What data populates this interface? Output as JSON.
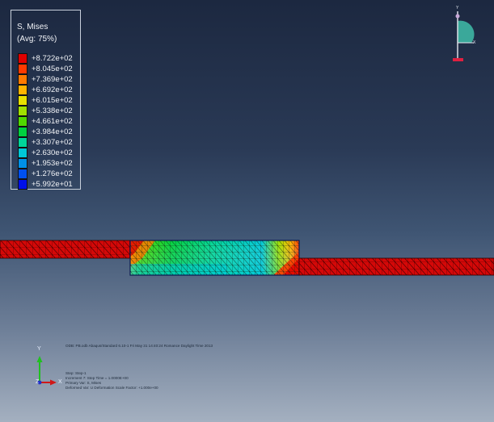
{
  "legend": {
    "title": "S, Mises",
    "subtitle": "(Avg: 75%)",
    "entries": [
      {
        "label": "+8.722e+02",
        "color": "#e00000"
      },
      {
        "label": "+8.045e+02",
        "color": "#ff3a00"
      },
      {
        "label": "+7.369e+02",
        "color": "#ff7a00"
      },
      {
        "label": "+6.692e+02",
        "color": "#ffb400"
      },
      {
        "label": "+6.015e+02",
        "color": "#e8e000"
      },
      {
        "label": "+5.338e+02",
        "color": "#a0e000"
      },
      {
        "label": "+4.661e+02",
        "color": "#50d800"
      },
      {
        "label": "+3.984e+02",
        "color": "#00d040"
      },
      {
        "label": "+3.307e+02",
        "color": "#00d49a"
      },
      {
        "label": "+2.630e+02",
        "color": "#00c8d8"
      },
      {
        "label": "+1.953e+02",
        "color": "#0090e8"
      },
      {
        "label": "+1.276e+02",
        "color": "#0050f0"
      },
      {
        "label": "+5.992e+01",
        "color": "#0010e8"
      }
    ]
  },
  "triad_top": {
    "y": "Y",
    "x": "X"
  },
  "triad_bottom": {
    "y": "Y",
    "z": "Z",
    "x": "X"
  },
  "info": {
    "line1": "ODB: PB.odb    Abaqus/Standard 6.10-1    Fri May 31 14:40:24 Romance Daylight Time 2013",
    "line2": "Step: Step-1",
    "line3": "Increment    7: Step Time =    1.0000E+00",
    "line4": "Primary Var: S, Mises",
    "line5": "Deformed Var: U   Deformation Scale Factor: +1.000e+00"
  }
}
